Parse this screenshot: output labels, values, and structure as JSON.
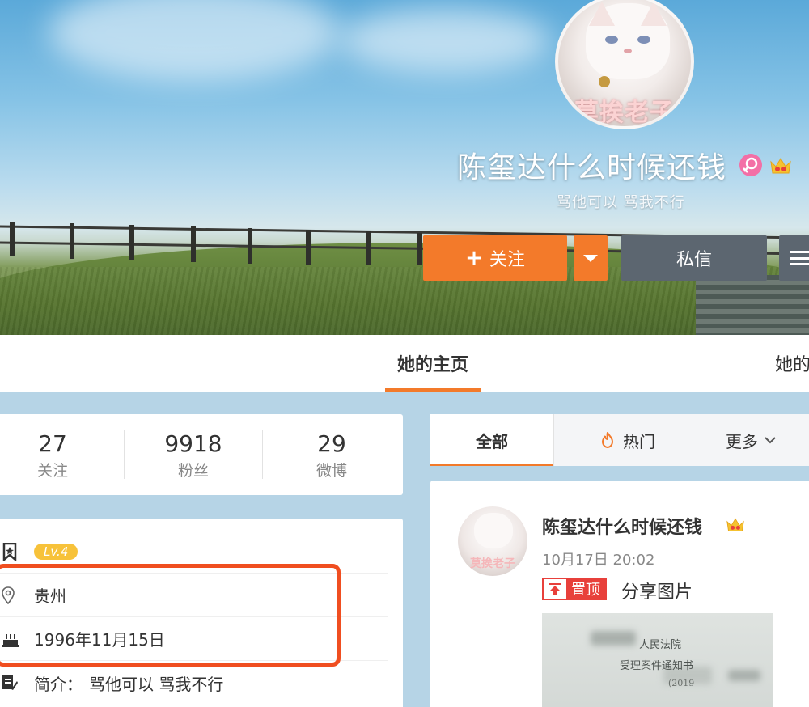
{
  "profile": {
    "name": "陈玺达什么时候还钱",
    "bio": "骂他可以 骂我不行",
    "avatar_text": "莫挨老子",
    "level": "Lv.4",
    "location": "贵州",
    "birthday": "1996年11月15日",
    "intro_label": "简介：",
    "intro": "骂他可以 骂我不行"
  },
  "actions": {
    "follow_plus": "+",
    "follow_label": "关注",
    "message_label": "私信"
  },
  "nav": {
    "home_tab": "她的主页",
    "other_tab": "她的"
  },
  "stats": [
    {
      "value": "27",
      "label": "关注"
    },
    {
      "value": "9918",
      "label": "粉丝"
    },
    {
      "value": "29",
      "label": "微博"
    }
  ],
  "feed_tabs": {
    "all": "全部",
    "hot": "热门",
    "more": "更多"
  },
  "post": {
    "author": "陈玺达什么时候还钱",
    "time": "10月17日 20:02",
    "pin_label": "置顶",
    "text": "分享图片",
    "avatar_text": "莫挨老子",
    "image_text_1": "人民法院",
    "image_text_2": "受理案件通知书",
    "image_text_3": "(2019"
  },
  "colors": {
    "accent": "#f37a2a",
    "highlight_border": "#f04e20",
    "dark_button": "#5c6670",
    "pin_red": "#e8403b",
    "level_badge": "#f7c23a"
  },
  "icons": {
    "gender": "female-icon",
    "vip": "vip-crown-icon",
    "level": "bookmark-icon",
    "location": "location-pin-icon",
    "birthday": "cake-icon",
    "intro": "edit-icon",
    "hot": "flame-icon",
    "more": "chevron-down-icon",
    "menu": "hamburger-icon"
  }
}
